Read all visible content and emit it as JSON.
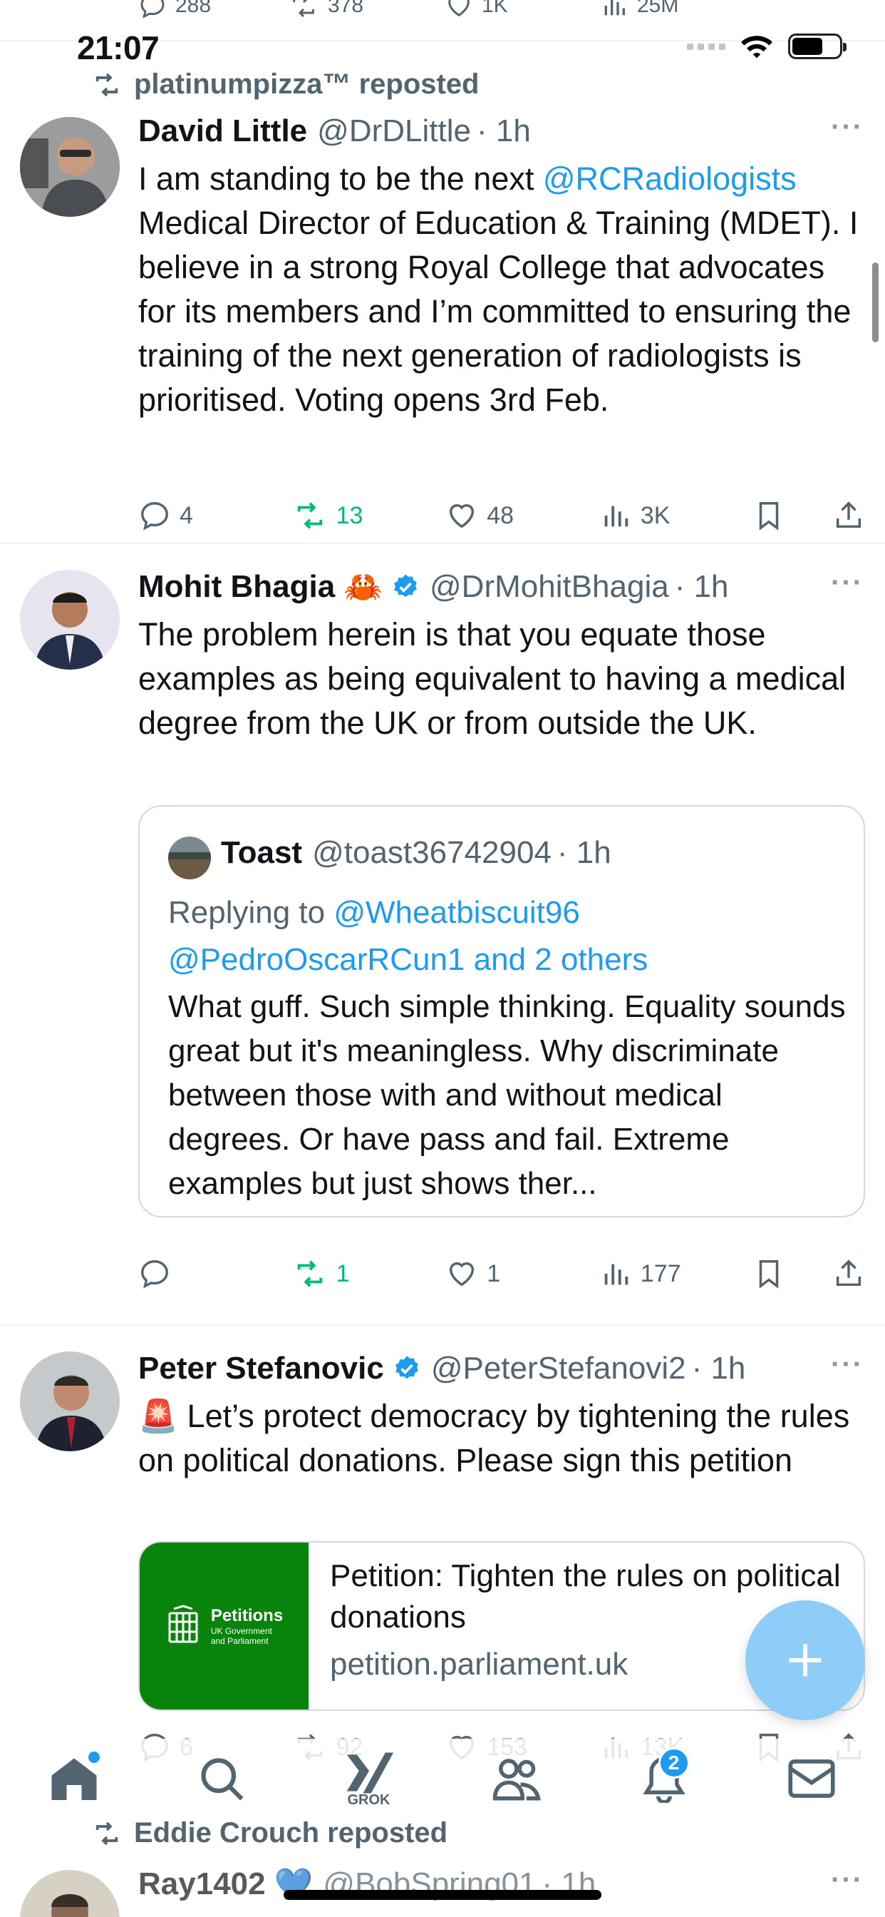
{
  "status_bar": {
    "time": "21:07"
  },
  "previous_tweet_actions": {
    "replies": "288",
    "reposts": "378",
    "likes": "1K",
    "views": "25M"
  },
  "tweets": [
    {
      "repost_label": "platinumpizza™ reposted",
      "name": "David Little",
      "handle": "@DrDLittle",
      "time": "· 1h",
      "text_before": "I am standing to be the next ",
      "mention": "@RCRadiologists",
      "text_after": " Medical Director of Education & Training (MDET). I believe in a strong Royal College that advocates for its members and I’m committed to ensuring the training of the next generation of radiologists is prioritised. Voting opens 3rd Feb.",
      "replies": "4",
      "reposts": "13",
      "likes": "48",
      "views": "3K"
    },
    {
      "name": "Mohit Bhagia",
      "emoji": "🦀",
      "handle": "@DrMohitBhagia",
      "time": "· 1h",
      "text": "The problem herein is that you equate those examples as being equivalent to having a medical degree from the UK or from outside the UK.",
      "quote": {
        "name": "Toast",
        "handle": "@toast36742904",
        "time": "· 1h",
        "replying_prefix": "Replying to ",
        "replying_line1": "@Wheatbiscuit96",
        "replying_line2": "@PedroOscarRCun1 and 2 others",
        "text": "What guff. Such simple thinking. Equality sounds great but it's meaningless. Why discriminate between those with and without medical degrees. Or have pass and fail. Extreme examples but just shows ther..."
      },
      "replies": "",
      "reposts": "1",
      "likes": "1",
      "views": "177"
    },
    {
      "name": "Peter Stefanovic",
      "handle": "@PeterStefanovi2",
      "time": "· 1h",
      "emoji": "🚨",
      "text": "Let’s protect democracy by tightening the rules on political donations. Please sign this petition",
      "card": {
        "logo_title": "Petitions",
        "logo_sub1": "UK Government",
        "logo_sub2": "and Parliament",
        "title": "Petition: Tighten the rules on political donations",
        "domain": "petition.parliament.uk"
      },
      "replies": "6",
      "reposts": "92",
      "likes": "153",
      "views": "13K"
    },
    {
      "repost_label": "Eddie Crouch reposted",
      "name": "Ray1402",
      "emoji": "💙",
      "handle": "@BobSpring01",
      "time": "· 1h"
    }
  ],
  "nav": {
    "grok_label": "GROK",
    "notifications_badge": "2"
  },
  "more_label": "···"
}
